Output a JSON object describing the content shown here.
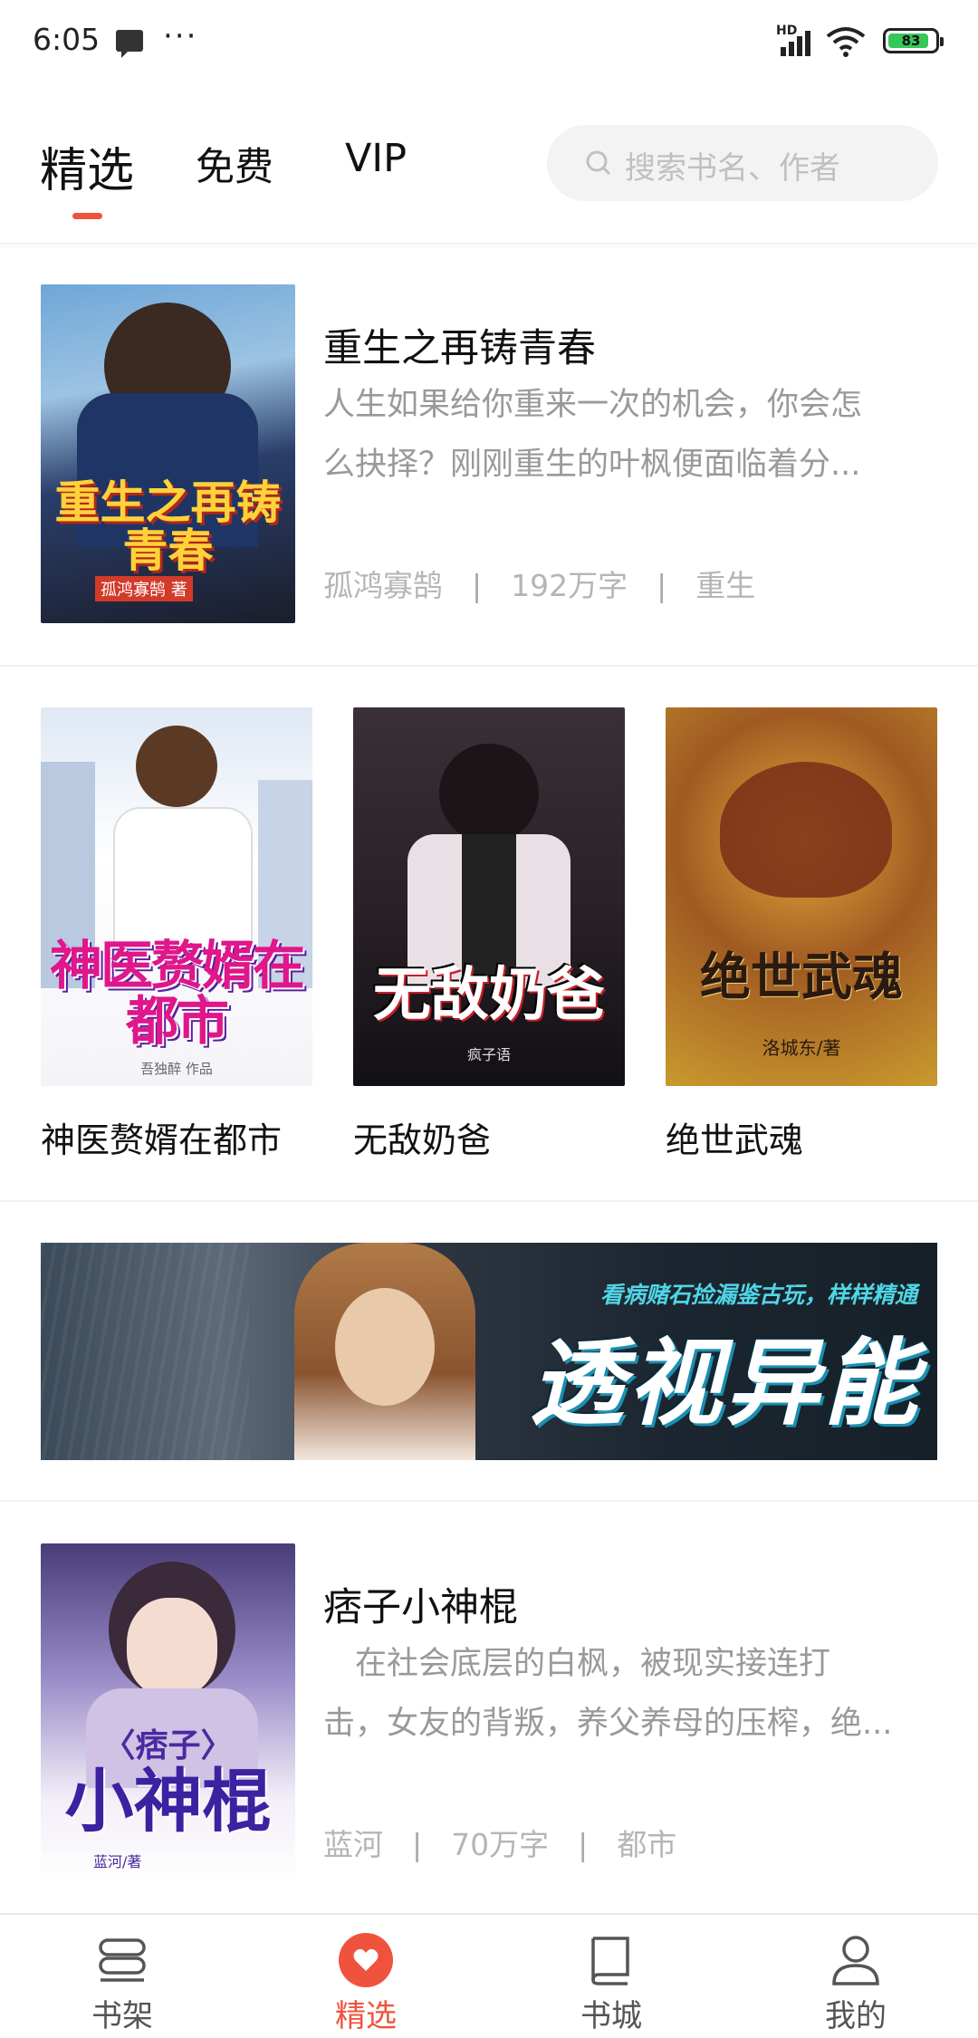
{
  "status_bar": {
    "time": "6:05",
    "hd": "HD",
    "battery": "83"
  },
  "top_tabs": [
    {
      "label": "精选"
    },
    {
      "label": "免费"
    },
    {
      "label": "VIP"
    }
  ],
  "search": {
    "placeholder": "搜索书名、作者"
  },
  "featured_1": {
    "cover_title": "重生之再铸青春",
    "cover_author": "孤鸿寡鹄 著",
    "title": "重生之再铸青春",
    "desc_lines": [
      "人生如果给你重来一次的机会，你会怎",
      "么抉择？刚刚重生的叶枫便面临着分..."
    ],
    "author": "孤鸿寡鹄",
    "words": "192万字",
    "tag": "重生"
  },
  "grid_books": [
    {
      "title": "神医赘婿在都市",
      "cover_title": "神医赘婿在都市",
      "cover_author": "吾独醉 作品"
    },
    {
      "title": "无敌奶爸",
      "cover_title": "无敌奶爸",
      "cover_author": "疯子语"
    },
    {
      "title": "绝世武魂",
      "cover_title": "绝世武魂",
      "cover_author": "洛城东/著"
    }
  ],
  "banner": {
    "subtitle": "看病赌石捡漏鉴古玩，样样精通",
    "title": "透视异能"
  },
  "featured_2": {
    "cover_title_top": "〈痞子〉",
    "cover_title": "小神棍",
    "cover_author": "蓝河/著",
    "title": "痞子小神棍",
    "desc_lines": [
      "　在社会底层的白枫，被现实接连打",
      "击，女友的背叛，养父养母的压榨，绝..."
    ],
    "author": "蓝河",
    "words": "70万字",
    "tag": "都市"
  },
  "bottom_nav": [
    {
      "label": "书架",
      "icon": "bookshelf-icon"
    },
    {
      "label": "精选",
      "icon": "heart-icon"
    },
    {
      "label": "书城",
      "icon": "book-icon"
    },
    {
      "label": "我的",
      "icon": "user-icon"
    }
  ],
  "colors": {
    "accent": "#f0533d",
    "text": "#222222",
    "muted": "#999999"
  }
}
